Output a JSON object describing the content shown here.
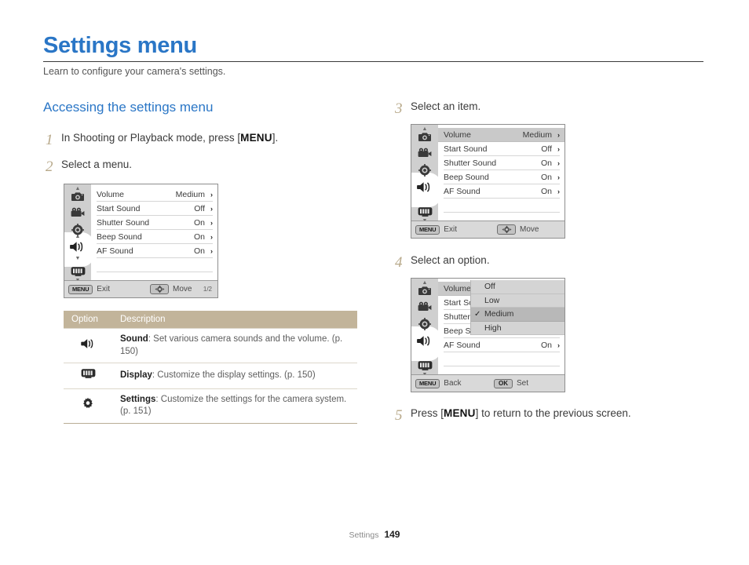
{
  "page": {
    "title": "Settings menu",
    "subtitle": "Learn to configure your camera's settings.",
    "section_title": "Accessing the settings menu",
    "accent_color": "#2a76c6",
    "step_number_color": "#b8a98a"
  },
  "steps": {
    "s1": {
      "num": "1",
      "text_before": "In Shooting or Playback mode, press [",
      "key": "MENU",
      "text_after": "]."
    },
    "s2": {
      "num": "2",
      "text": "Select a menu."
    },
    "s3": {
      "num": "3",
      "text": "Select an item."
    },
    "s4": {
      "num": "4",
      "text": "Select an option."
    },
    "s5": {
      "num": "5",
      "text_before": "Press [",
      "key": "MENU",
      "text_after": "] to return to the previous screen."
    }
  },
  "lcd_common": {
    "sidebar_icons": [
      "camera-icon",
      "movie-icon",
      "focus-icon",
      "sound-icon",
      "display-icon"
    ],
    "selected_sidebar_icon": "sound-icon",
    "rows": [
      {
        "label": "Volume",
        "value": "Medium",
        "chevron": "›"
      },
      {
        "label": "Start Sound",
        "value": "Off",
        "chevron": "›"
      },
      {
        "label": "Shutter Sound",
        "value": "On",
        "chevron": "›"
      },
      {
        "label": "Beep Sound",
        "value": "On",
        "chevron": "›"
      },
      {
        "label": "AF Sound",
        "value": "On",
        "chevron": "›"
      }
    ]
  },
  "lcd1": {
    "bar_key_left": "MENU",
    "bar_label_left": "Exit",
    "bar_key_mid": "nav-pad-icon",
    "bar_label_mid": "Move",
    "page_indicator": "1/2",
    "selected_row_index": -1
  },
  "lcd2": {
    "bar_key_left": "MENU",
    "bar_label_left": "Exit",
    "bar_key_mid": "nav-pad-icon",
    "bar_label_mid": "Move",
    "selected_row_index": 0
  },
  "lcd3": {
    "bar_key_left": "MENU",
    "bar_label_left": "Back",
    "bar_key_mid": "OK",
    "bar_label_mid": "Set",
    "selected_row_index": 0,
    "popup": {
      "options": [
        {
          "label": "Off",
          "checked": false
        },
        {
          "label": "Low",
          "checked": false
        },
        {
          "label": "Medium",
          "checked": true
        },
        {
          "label": "High",
          "checked": false
        }
      ],
      "check_glyph": "✓"
    },
    "masked_rows": [
      {
        "label": "Volume",
        "value": "",
        "chevron": ""
      },
      {
        "label": "Start Sound",
        "value": "",
        "chevron": ""
      },
      {
        "label": "Shutter Sou",
        "value": "",
        "chevron": ""
      },
      {
        "label": "Beep Sound",
        "value": "",
        "chevron": ""
      },
      {
        "label": "AF Sound",
        "value": "On",
        "chevron": "›"
      }
    ]
  },
  "option_table": {
    "header": {
      "col1": "Option",
      "col2": "Description"
    },
    "rows": [
      {
        "icon": "sound-icon",
        "title": "Sound",
        "desc": ": Set various camera sounds and the volume. (p. 150)"
      },
      {
        "icon": "display-icon",
        "title": "Display",
        "desc": ": Customize the display settings. (p. 150)"
      },
      {
        "icon": "settings-icon",
        "title": "Settings",
        "desc": ": Customize the settings for the camera system. (p. 151)"
      }
    ]
  },
  "footer": {
    "label": "Settings",
    "page_number": "149"
  }
}
